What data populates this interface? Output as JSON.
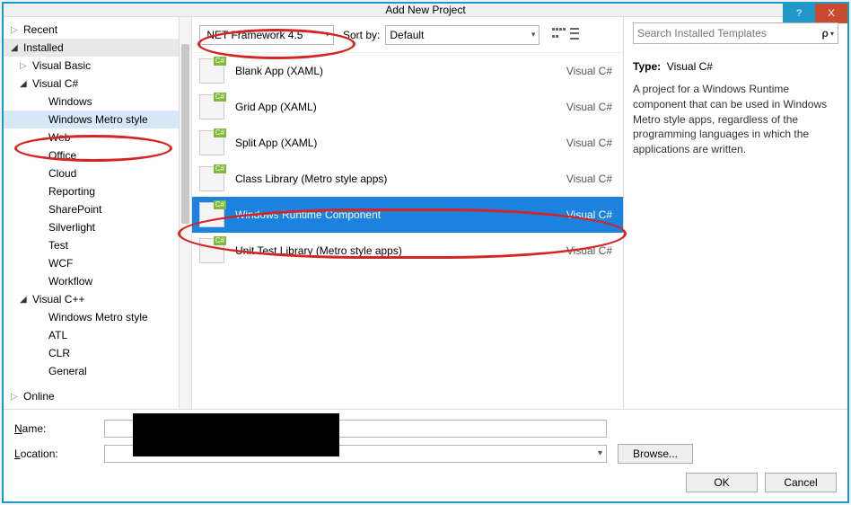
{
  "window": {
    "title": "Add New Project",
    "help": "?",
    "close_icon": "X"
  },
  "tree": {
    "recent": "Recent",
    "installed": "Installed",
    "vb": "Visual Basic",
    "csharp": "Visual C#",
    "cs_items": [
      "Windows",
      "Windows Metro style",
      "Web",
      "Office",
      "Cloud",
      "Reporting",
      "SharePoint",
      "Silverlight",
      "Test",
      "WCF",
      "Workflow"
    ],
    "vcpp": "Visual C++",
    "vcpp_items": [
      "Windows Metro style",
      "ATL",
      "CLR",
      "General"
    ],
    "online": "Online"
  },
  "toolbar": {
    "framework": ".NET Framework 4.5",
    "sortby_label": "Sort by:",
    "sortby_value": "Default"
  },
  "templates": [
    {
      "name": "Blank App (XAML)",
      "lang": "Visual C#"
    },
    {
      "name": "Grid App (XAML)",
      "lang": "Visual C#"
    },
    {
      "name": "Split App (XAML)",
      "lang": "Visual C#"
    },
    {
      "name": "Class Library (Metro style apps)",
      "lang": "Visual C#"
    },
    {
      "name": "Windows Runtime Component",
      "lang": "Visual C#"
    },
    {
      "name": "Unit Test Library (Metro style apps)",
      "lang": "Visual C#"
    }
  ],
  "right": {
    "search_placeholder": "Search Installed Templates",
    "type_label": "Type:",
    "type_value": "Visual C#",
    "description": "A project for a Windows Runtime component that can be used in Windows Metro style apps, regardless of the programming languages in which the applications are written."
  },
  "bottom": {
    "name_label_pre": "N",
    "name_label_post": "ame:",
    "loc_label_pre": "L",
    "loc_label_post": "ocation:",
    "browse": "Browse...",
    "ok": "OK",
    "cancel": "Cancel"
  }
}
